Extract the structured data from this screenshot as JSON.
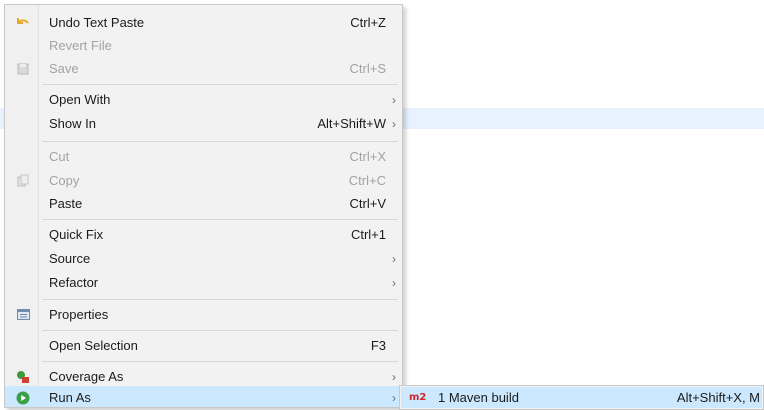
{
  "menu": {
    "items": [
      {
        "label": "Undo Text Paste",
        "shortcut": "Ctrl+Z",
        "icon": "undo-icon"
      },
      {
        "label": "Revert File",
        "shortcut": ""
      },
      {
        "label": "Save",
        "shortcut": "Ctrl+S",
        "icon": "save-icon"
      },
      {
        "label": "Open With",
        "shortcut": "",
        "submenu": true
      },
      {
        "label": "Show In",
        "shortcut": "Alt+Shift+W",
        "submenu": true
      },
      {
        "label": "Cut",
        "shortcut": "Ctrl+X"
      },
      {
        "label": "Copy",
        "shortcut": "Ctrl+C",
        "icon": "copy-icon"
      },
      {
        "label": "Paste",
        "shortcut": "Ctrl+V"
      },
      {
        "label": "Quick Fix",
        "shortcut": "Ctrl+1"
      },
      {
        "label": "Source",
        "shortcut": "",
        "submenu": true
      },
      {
        "label": "Refactor",
        "shortcut": "",
        "submenu": true
      },
      {
        "label": "Properties",
        "shortcut": "",
        "icon": "properties-icon"
      },
      {
        "label": "Open Selection",
        "shortcut": "F3"
      },
      {
        "label": "Coverage As",
        "shortcut": "",
        "submenu": true,
        "icon": "coverage-icon"
      },
      {
        "label": "Run As",
        "shortcut": "",
        "submenu": true,
        "icon": "run-icon"
      }
    ],
    "arrow": "›"
  },
  "submenu": {
    "icon_text": "m2",
    "label": "1 Maven build",
    "shortcut": "Alt+Shift+X, M"
  },
  "colors": {
    "highlight": "#cce8ff",
    "menu_bg": "#f2f2f2",
    "editor_line": "#e8f2fe",
    "run_icon": "#3aa04a",
    "undo_icon": "#e8a92a"
  }
}
